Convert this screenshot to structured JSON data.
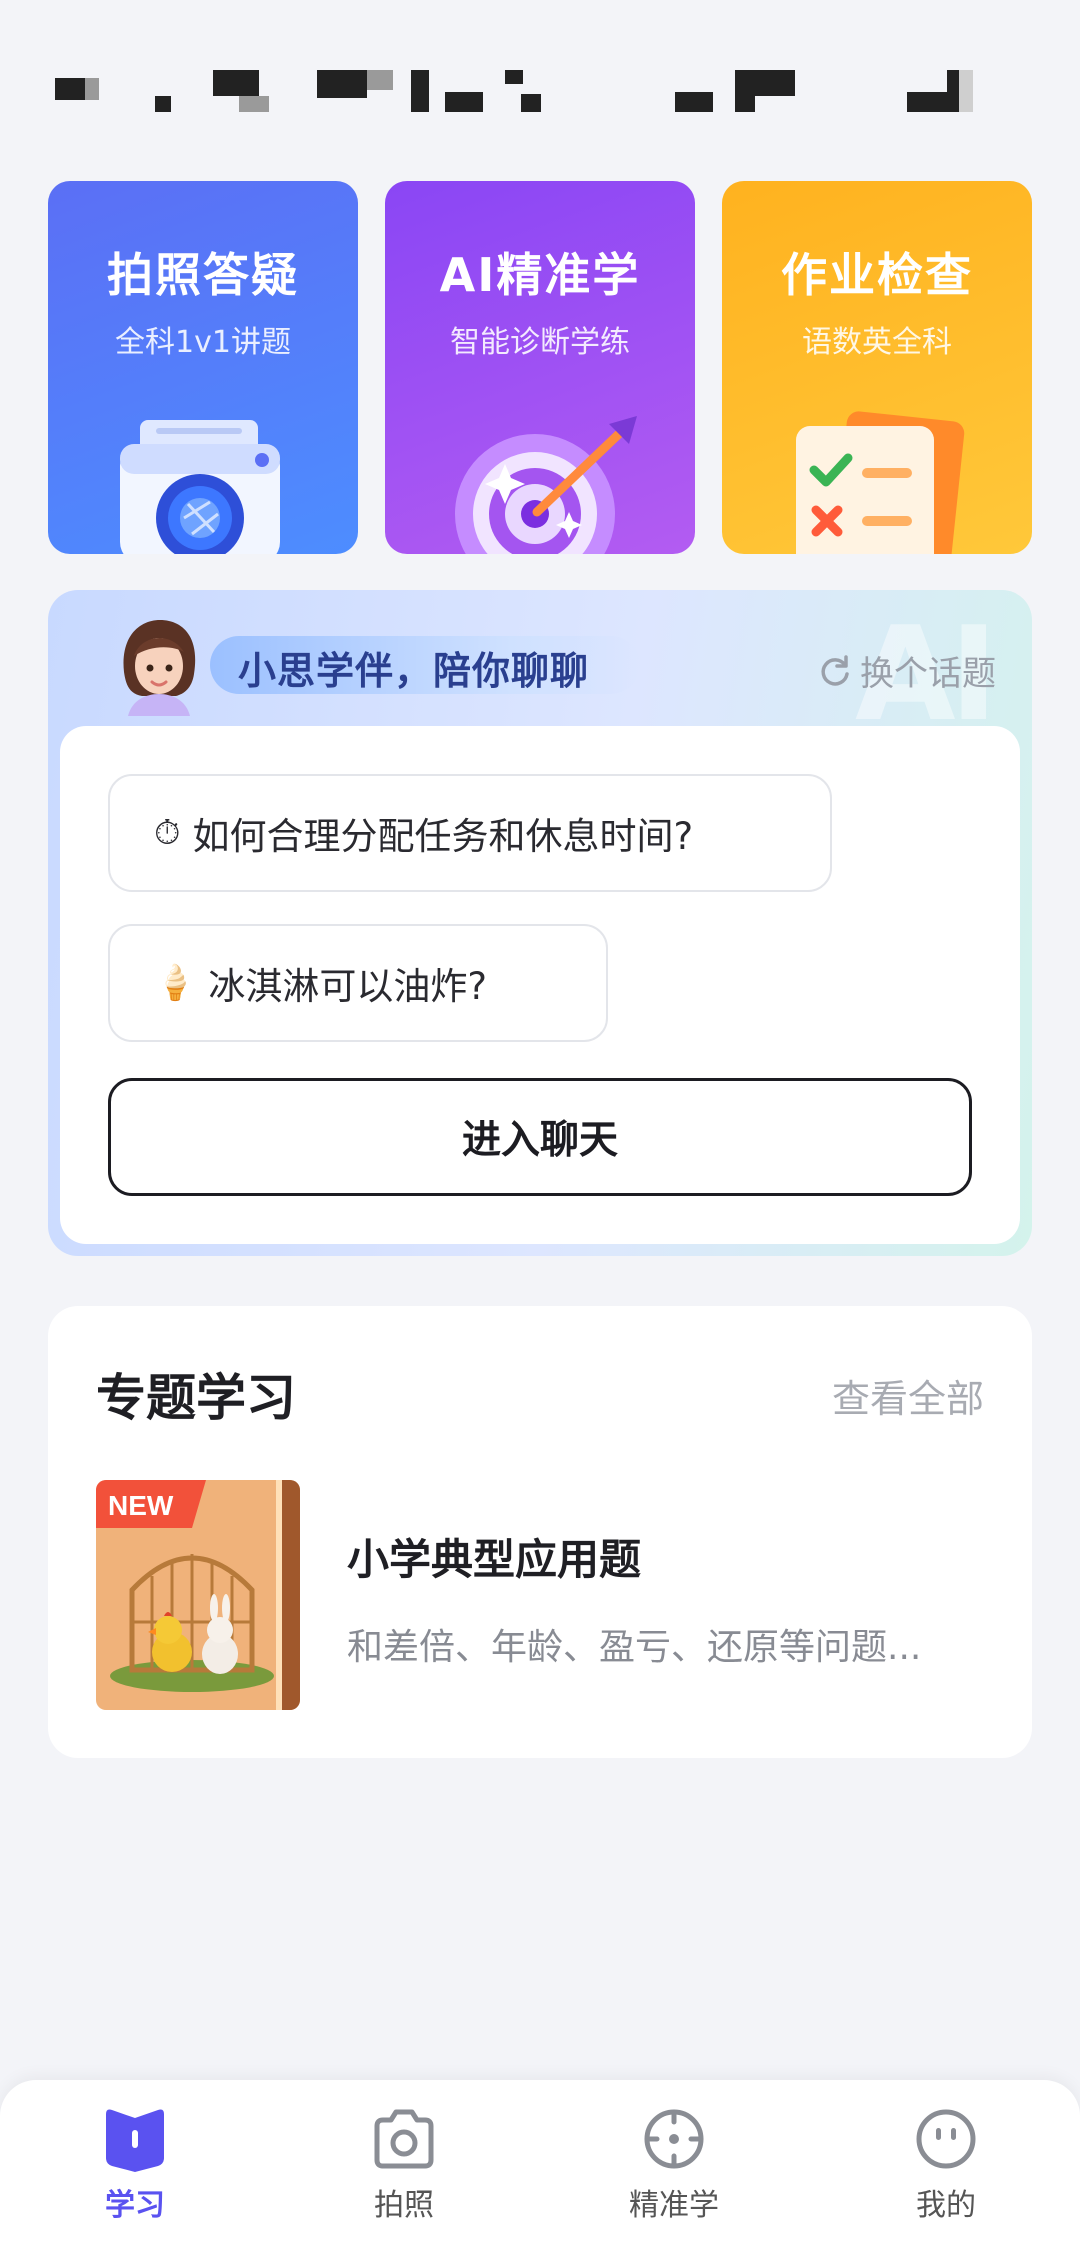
{
  "features": [
    {
      "title": "拍照答疑",
      "subtitle": "全科1v1讲题"
    },
    {
      "title": "AI精准学",
      "subtitle": "智能诊断学练"
    },
    {
      "title": "作业检查",
      "subtitle": "语数英全科"
    }
  ],
  "chat": {
    "title": "小思学伴，陪你聊聊",
    "refresh_label": "换个话题",
    "watermark": "AI",
    "topics": [
      {
        "emoji": "⏱",
        "text": "如何合理分配任务和休息时间?"
      },
      {
        "emoji": "🍦",
        "text": "冰淇淋可以油炸?"
      }
    ],
    "enter_label": "进入聊天"
  },
  "study": {
    "title": "专题学习",
    "view_all": "查看全部",
    "course": {
      "badge": "NEW",
      "name": "小学典型应用题",
      "desc": "和差倍、年龄、盈亏、还原等问题..."
    }
  },
  "nav": [
    {
      "label": "学习",
      "icon": "book-icon",
      "active": true
    },
    {
      "label": "拍照",
      "icon": "camera-icon",
      "active": false
    },
    {
      "label": "精准学",
      "icon": "target-icon",
      "active": false
    },
    {
      "label": "我的",
      "icon": "face-icon",
      "active": false
    }
  ],
  "colors": {
    "accent": "#5a52f0",
    "photo_card": "#5b6ff5",
    "ai_card": "#8a46f4",
    "hw_card": "#ffb21f"
  }
}
